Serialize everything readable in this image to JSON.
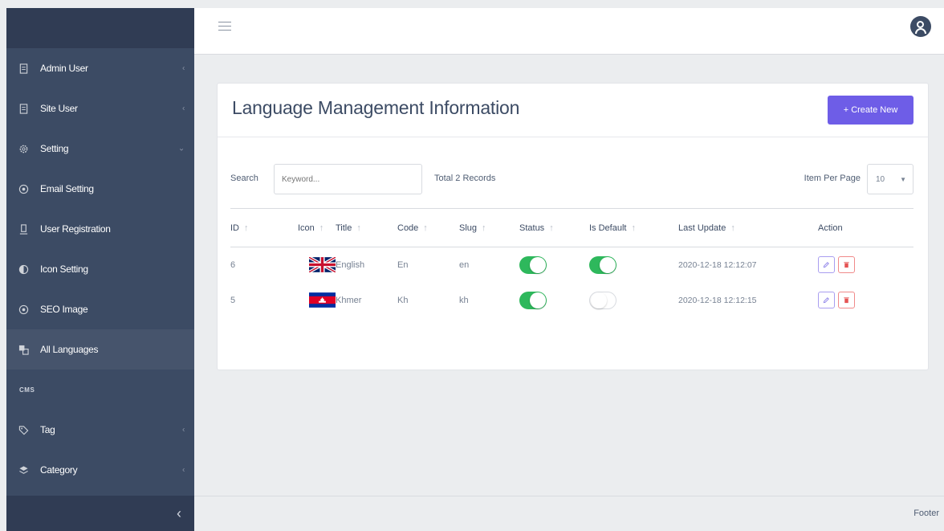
{
  "sidebar": {
    "items": [
      {
        "label": "Admin User",
        "icon": "document-icon",
        "caret": "‹"
      },
      {
        "label": "Site User",
        "icon": "document-icon",
        "caret": "‹"
      },
      {
        "label": "Setting",
        "icon": "gear-icon",
        "caret": "⌄"
      },
      {
        "label": "Email Setting",
        "icon": "globe-icon"
      },
      {
        "label": "User Registration",
        "icon": "user-icon"
      },
      {
        "label": "Icon Setting",
        "icon": "contrast-icon"
      },
      {
        "label": "SEO Image",
        "icon": "globe-icon"
      },
      {
        "label": "All Languages",
        "icon": "language-icon"
      }
    ],
    "section_label": "CMS",
    "cms_items": [
      {
        "label": "Tag",
        "icon": "tag-icon",
        "caret": "‹"
      },
      {
        "label": "Category",
        "icon": "layers-icon",
        "caret": "‹"
      }
    ],
    "toggle": "‹"
  },
  "header": {
    "menu_icon": "hamburger-icon",
    "avatar_icon": "user-avatar-icon"
  },
  "card": {
    "title": "Language Management Information",
    "create_button": "+ Create New"
  },
  "toolbar": {
    "search_label": "Search",
    "search_placeholder": "Keyword...",
    "total": "Total 2 Records",
    "items_per_page_label": "Item Per Page",
    "items_per_page_value": "10"
  },
  "table": {
    "columns": [
      "ID",
      "Icon",
      "Title",
      "Code",
      "Slug",
      "Status",
      "Is Default",
      "Last Update",
      "Action"
    ],
    "rows": [
      {
        "id": "6",
        "flag": "uk-flag-icon",
        "title": "English",
        "code": "En",
        "slug": "en",
        "status": true,
        "is_default": true,
        "last_update": "2020-12-18 12:12:07"
      },
      {
        "id": "5",
        "flag": "cambodia-flag-icon",
        "title": "Khmer",
        "code": "Kh",
        "slug": "kh",
        "status": true,
        "is_default": false,
        "last_update": "2020-12-18 12:12:15"
      }
    ]
  },
  "footer": {
    "text": "Footer"
  },
  "colors": {
    "sidebar": "#3c4b64",
    "primary": "#6e5de7",
    "success": "#2eb85c",
    "danger": "#e55353"
  }
}
